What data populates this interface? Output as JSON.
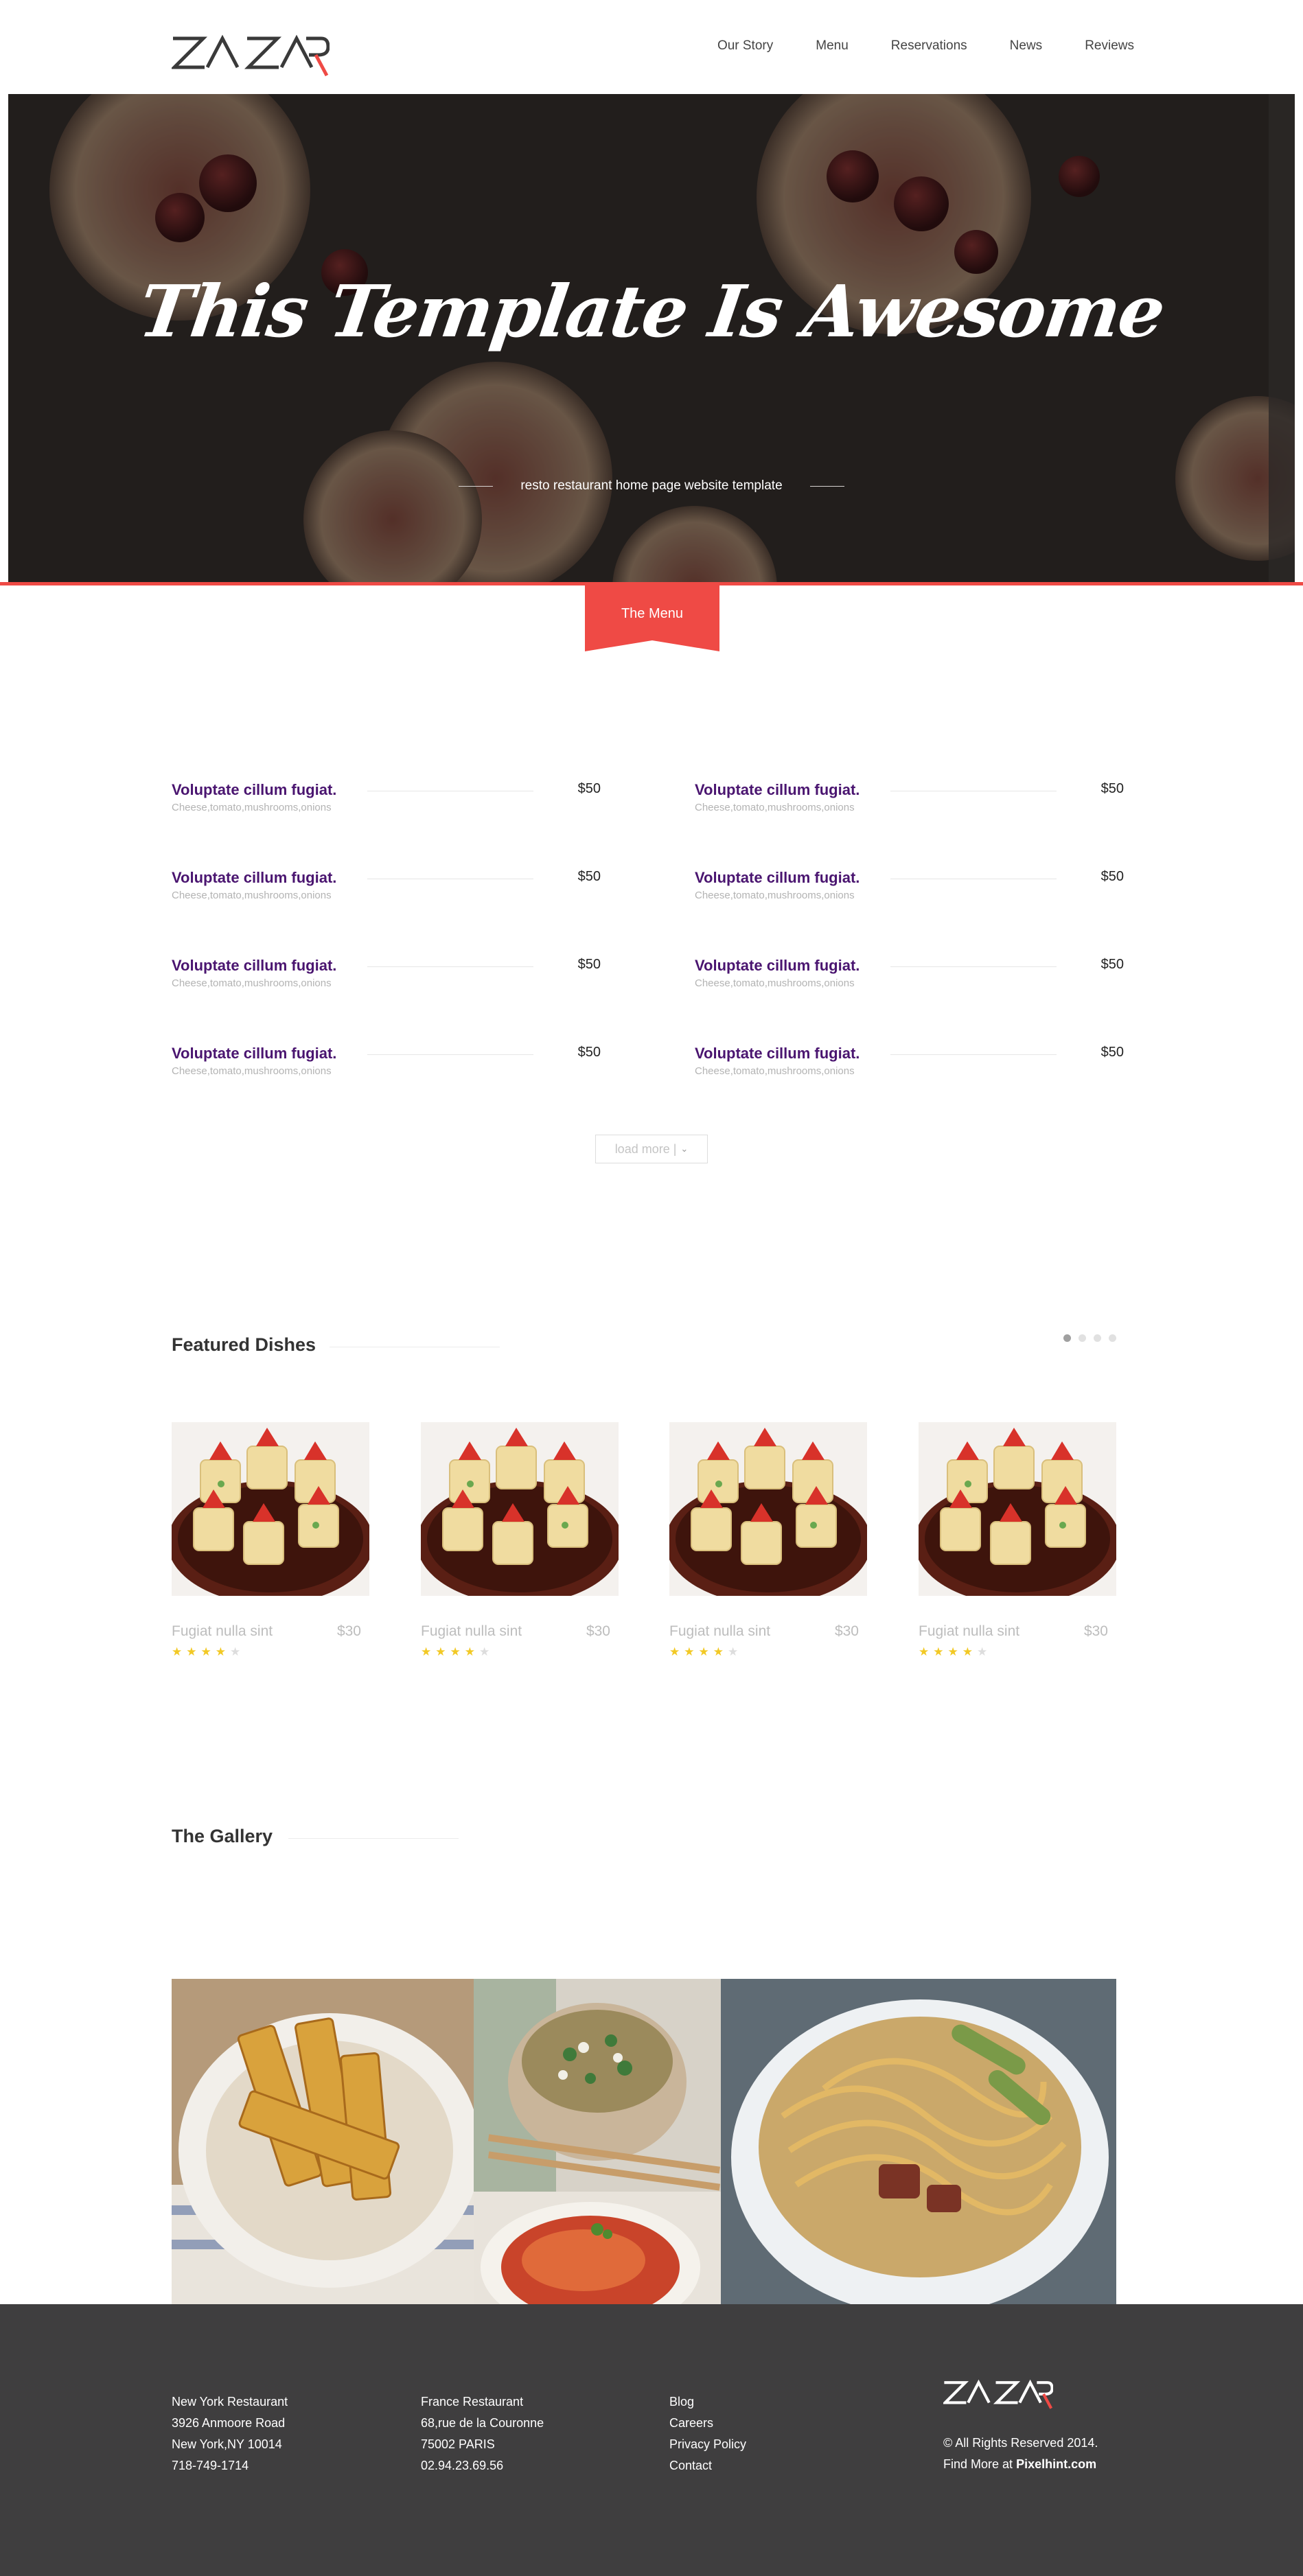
{
  "brand": {
    "logo_text": "ZA ZAR"
  },
  "nav": [
    "Our Story",
    "Menu",
    "Reservations",
    "News",
    "Reviews"
  ],
  "hero": {
    "title": "This Template Is Awesome",
    "subtitle": "resto restaurant home page website template"
  },
  "menu_tab": {
    "label": "The Menu"
  },
  "menu_items": [
    {
      "name": "Voluptate cillum fugiat.",
      "desc": "Cheese,tomato,mushrooms,onions",
      "price": "$50"
    },
    {
      "name": "Voluptate cillum fugiat.",
      "desc": "Cheese,tomato,mushrooms,onions",
      "price": "$50"
    },
    {
      "name": "Voluptate cillum fugiat.",
      "desc": "Cheese,tomato,mushrooms,onions",
      "price": "$50"
    },
    {
      "name": "Voluptate cillum fugiat.",
      "desc": "Cheese,tomato,mushrooms,onions",
      "price": "$50"
    },
    {
      "name": "Voluptate cillum fugiat.",
      "desc": "Cheese,tomato,mushrooms,onions",
      "price": "$50"
    },
    {
      "name": "Voluptate cillum fugiat.",
      "desc": "Cheese,tomato,mushrooms,onions",
      "price": "$50"
    },
    {
      "name": "Voluptate cillum fugiat.",
      "desc": "Cheese,tomato,mushrooms,onions",
      "price": "$50"
    },
    {
      "name": "Voluptate cillum fugiat.",
      "desc": "Cheese,tomato,mushrooms,onions",
      "price": "$50"
    }
  ],
  "load_more": {
    "label": "load more |"
  },
  "featured": {
    "title": "Featured Dishes",
    "pager": {
      "pages": 4,
      "active": 1
    },
    "dishes": [
      {
        "name": "Fugiat nulla sint",
        "price": "$30",
        "rating": 4,
        "max_rating": 5
      },
      {
        "name": "Fugiat nulla sint",
        "price": "$30",
        "rating": 4,
        "max_rating": 5
      },
      {
        "name": "Fugiat nulla sint",
        "price": "$30",
        "rating": 4,
        "max_rating": 5
      },
      {
        "name": "Fugiat nulla sint",
        "price": "$30",
        "rating": 4,
        "max_rating": 5
      }
    ]
  },
  "gallery": {
    "title": "The Gallery"
  },
  "footer": {
    "col1": [
      "New York Restaurant",
      "3926 Anmoore Road",
      "New York,NY 10014",
      "718-749-1714"
    ],
    "col2": [
      "France Restaurant",
      "68,rue de la Couronne",
      "75002 PARIS",
      "02.94.23.69.56"
    ],
    "col3": [
      "Blog",
      "Careers",
      "Privacy Policy",
      "Contact"
    ],
    "copyright": "© All Rights Reserved 2014.",
    "find_more_prefix": "Find More at",
    "find_more_link": "Pixelhint.com"
  },
  "colors": {
    "accent_red": "#ef4a45",
    "dish_name_purple": "#4a1570",
    "star_yellow": "#f2c925",
    "footer_bg": "#3f3e3f"
  },
  "icons": [
    "chevron-down-icon",
    "star-icon"
  ]
}
